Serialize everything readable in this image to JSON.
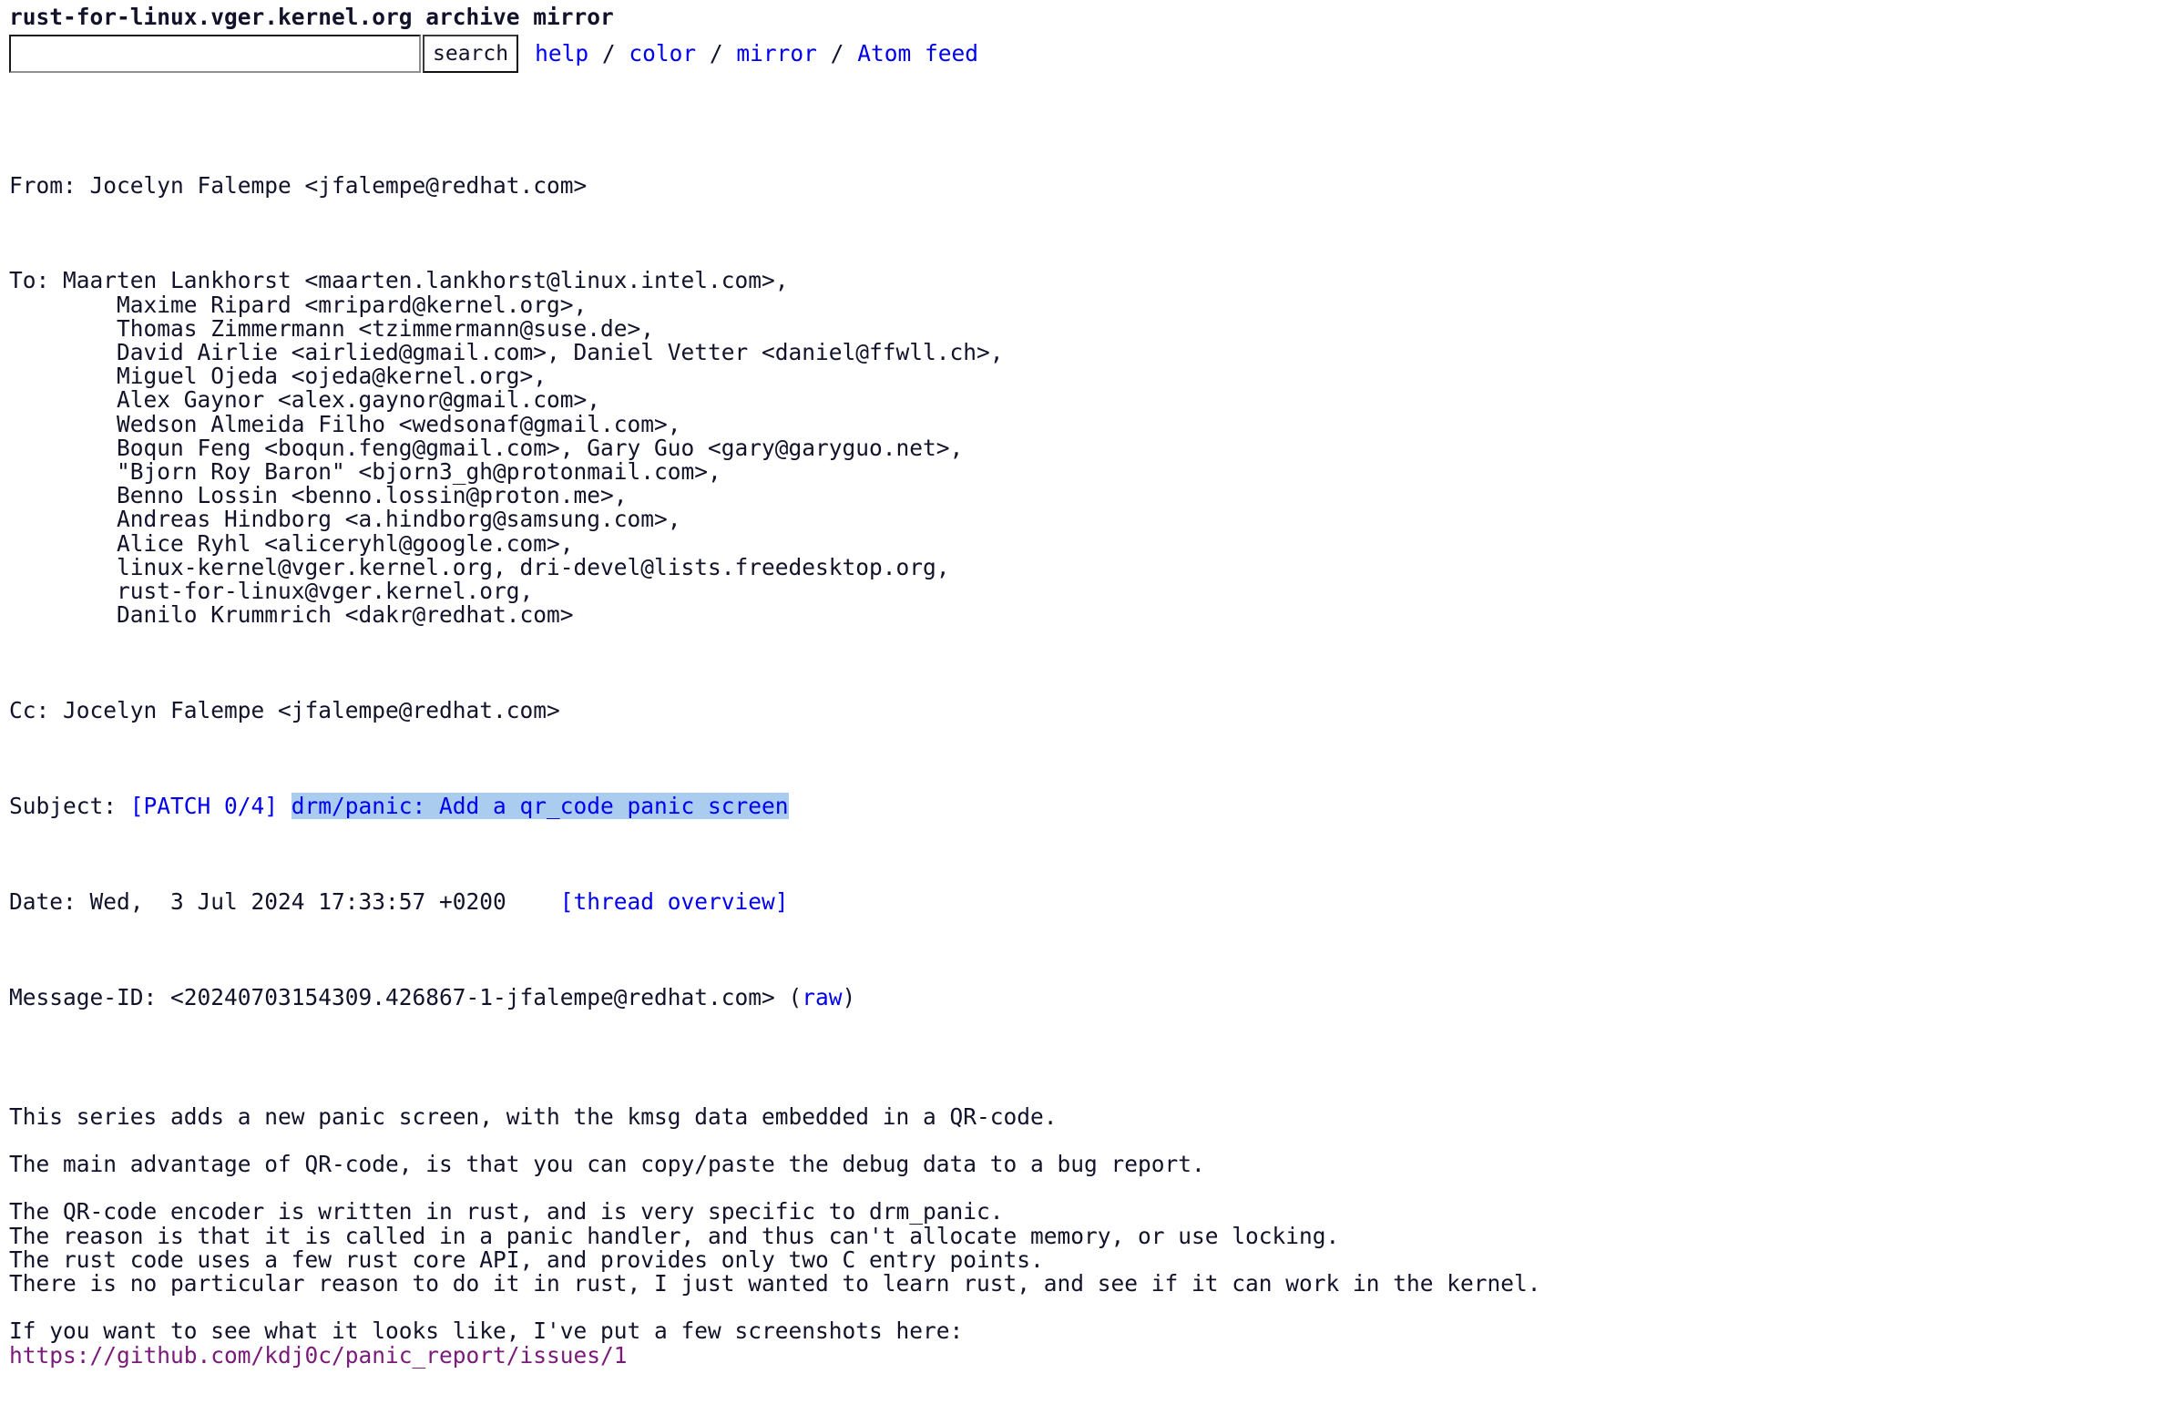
{
  "header": {
    "site_title": "rust-for-linux.vger.kernel.org archive mirror",
    "search": {
      "value": "",
      "placeholder": "",
      "button_label": "search"
    },
    "nav": {
      "help": "help",
      "color": "color",
      "mirror": "mirror",
      "atom_feed": "Atom feed",
      "separator": " / "
    }
  },
  "message": {
    "from_label": "From: ",
    "from_value": "Jocelyn Falempe <jfalempe@redhat.com>",
    "to_label": "To: ",
    "to_lines": [
      "Maarten Lankhorst <maarten.lankhorst@linux.intel.com>,",
      "        Maxime Ripard <mripard@kernel.org>,",
      "        Thomas Zimmermann <tzimmermann@suse.de>,",
      "        David Airlie <airlied@gmail.com>, Daniel Vetter <daniel@ffwll.ch>,",
      "        Miguel Ojeda <ojeda@kernel.org>,",
      "        Alex Gaynor <alex.gaynor@gmail.com>,",
      "        Wedson Almeida Filho <wedsonaf@gmail.com>,",
      "        Boqun Feng <boqun.feng@gmail.com>, Gary Guo <gary@garyguo.net>,",
      "        \"Bjorn Roy Baron\" <bjorn3_gh@protonmail.com>,",
      "        Benno Lossin <benno.lossin@proton.me>,",
      "        Andreas Hindborg <a.hindborg@samsung.com>,",
      "        Alice Ryhl <aliceryhl@google.com>,",
      "        linux-kernel@vger.kernel.org, dri-devel@lists.freedesktop.org,",
      "        rust-for-linux@vger.kernel.org,",
      "        Danilo Krummrich <dakr@redhat.com>"
    ],
    "cc_label": "Cc: ",
    "cc_value": "Jocelyn Falempe <jfalempe@redhat.com>",
    "subject_label": "Subject: ",
    "subject_prefix": "[PATCH 0/4] ",
    "subject_highlight": "drm/panic: Add a qr_code panic screen",
    "date_label": "Date: ",
    "date_value": "Wed,  3 Jul 2024 17:33:57 +0200",
    "date_gap": "    ",
    "thread_overview": "[thread overview]",
    "messageid_label": "Message-ID: ",
    "messageid_value": "<20240703154309.426867-1-jfalempe@redhat.com> (",
    "raw_label": "raw",
    "messageid_close": ")"
  },
  "body": {
    "paragraphs": [
      [
        "This series adds a new panic screen, with the kmsg data embedded in a QR-code."
      ],
      [
        "The main advantage of QR-code, is that you can copy/paste the debug data to a bug report."
      ],
      [
        "The QR-code encoder is written in rust, and is very specific to drm_panic.",
        "The reason is that it is called in a panic handler, and thus can't allocate memory, or use locking.",
        "The rust code uses a few rust core API, and provides only two C entry points.",
        "There is no particular reason to do it in rust, I just wanted to learn rust, and see if it can work in the kernel."
      ],
      [
        "If you want to see what it looks like, I've put a few screenshots here:"
      ]
    ],
    "link_url": "https://github.com/kdj0c/panic_report/issues/1"
  },
  "colors": {
    "link": "#0000ee",
    "visited_link": "#7a1a7a",
    "text": "#12122b",
    "highlight_bg": "#aaccee",
    "background": "#ffffff"
  }
}
